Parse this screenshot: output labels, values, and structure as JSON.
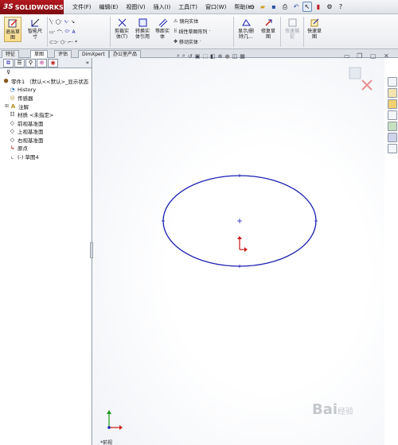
{
  "app": {
    "brand_prefix": "3S",
    "brand": "SOLIDWORKS"
  },
  "menu": [
    "文件(F)",
    "编辑(E)",
    "视图(V)",
    "插入(I)",
    "工具(T)",
    "窗口(W)",
    "帮助(H)"
  ],
  "ribbon": {
    "exit_sketch": "退出草\n图",
    "smart_dim": "智能尺\n寸",
    "trim": "剪裁实\n体(T)",
    "convert": "转换实\n体引用",
    "offset": "等距实\n体",
    "mirror": "镜向实体",
    "linear_pattern": "线性草图阵列",
    "move": "移动实体",
    "display_delete": "显示/删\n除几...",
    "repair": "修复草\n图",
    "quick_snap": "快速捕\n捉",
    "rapid_sketch": "快速草\n图"
  },
  "cmd_tabs": [
    "特征",
    "草图",
    "评估",
    "DimXpert",
    "办公室产品"
  ],
  "active_cmd_tab": "草图",
  "tree": {
    "root": "零件1 （默认<<默认>_显示状态",
    "items": [
      {
        "label": "History",
        "icon": "history-icon"
      },
      {
        "label": "传感器",
        "icon": "sensor-icon"
      },
      {
        "label": "注解",
        "icon": "annotation-icon",
        "expandable": true
      },
      {
        "label": "材质 <未指定>",
        "icon": "material-icon"
      },
      {
        "label": "前视基准面",
        "icon": "plane-icon"
      },
      {
        "label": "上视基准面",
        "icon": "plane-icon"
      },
      {
        "label": "右视基准面",
        "icon": "plane-icon"
      },
      {
        "label": "原点",
        "icon": "origin-icon"
      },
      {
        "label": "(-) 草图4",
        "icon": "sketch-icon"
      }
    ]
  },
  "sketch": {
    "shape": "ellipse",
    "color": "#1a1fb0"
  },
  "status": {
    "view_label": "*前视"
  },
  "watermark": {
    "text": "Bai",
    "suffix": "经验"
  }
}
